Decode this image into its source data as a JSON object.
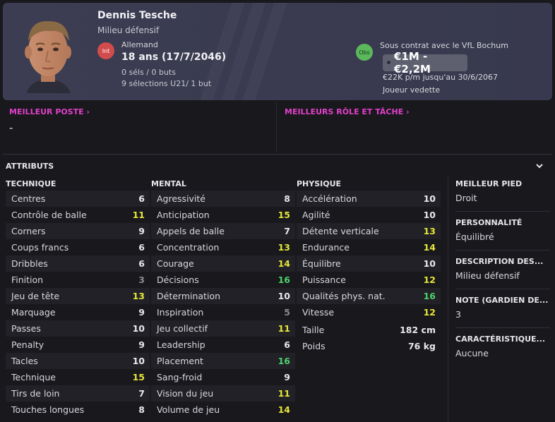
{
  "player": {
    "name": "Dennis Tesche",
    "position": "Milieu défensif",
    "int_badge": "Int",
    "nationality": "Allemand",
    "age": "18 ans (17/7/2046)",
    "caps": "0 séls / 0 buts",
    "u21": "9 sélections U21/ 1 but",
    "obs_badge": "Obs",
    "contract": "Sous contrat avec le VfL Bochum",
    "value": "€1M - €2,2M",
    "wage": "€22K p/m jusqu'au 30/6/2067",
    "status": "Joueur vedette"
  },
  "best": {
    "position_title": "MEILLEUR POSTE",
    "position_value": "-",
    "role_title": "MEILLEURS RÔLE ET TÂCHE"
  },
  "attributes": {
    "header": "ATTRIBUTS",
    "technique_title": "TECHNIQUE",
    "mental_title": "MENTAL",
    "physique_title": "PHYSIQUE",
    "technique": [
      {
        "label": "Centres",
        "value": "6"
      },
      {
        "label": "Contrôle de balle",
        "value": "11"
      },
      {
        "label": "Corners",
        "value": "9"
      },
      {
        "label": "Coups francs",
        "value": "6"
      },
      {
        "label": "Dribbles",
        "value": "6"
      },
      {
        "label": "Finition",
        "value": "3"
      },
      {
        "label": "Jeu de tête",
        "value": "13"
      },
      {
        "label": "Marquage",
        "value": "9"
      },
      {
        "label": "Passes",
        "value": "10"
      },
      {
        "label": "Penalty",
        "value": "9"
      },
      {
        "label": "Tacles",
        "value": "10"
      },
      {
        "label": "Technique",
        "value": "15"
      },
      {
        "label": "Tirs de loin",
        "value": "7"
      },
      {
        "label": "Touches longues",
        "value": "8"
      }
    ],
    "mental": [
      {
        "label": "Agressivité",
        "value": "8"
      },
      {
        "label": "Anticipation",
        "value": "15"
      },
      {
        "label": "Appels de balle",
        "value": "7"
      },
      {
        "label": "Concentration",
        "value": "13"
      },
      {
        "label": "Courage",
        "value": "14"
      },
      {
        "label": "Décisions",
        "value": "16"
      },
      {
        "label": "Détermination",
        "value": "10"
      },
      {
        "label": "Inspiration",
        "value": "5"
      },
      {
        "label": "Jeu collectif",
        "value": "11"
      },
      {
        "label": "Leadership",
        "value": "6"
      },
      {
        "label": "Placement",
        "value": "16"
      },
      {
        "label": "Sang-froid",
        "value": "9"
      },
      {
        "label": "Vision du jeu",
        "value": "11"
      },
      {
        "label": "Volume de jeu",
        "value": "14"
      }
    ],
    "physique": [
      {
        "label": "Accélération",
        "value": "10"
      },
      {
        "label": "Agilité",
        "value": "10"
      },
      {
        "label": "Détente verticale",
        "value": "13"
      },
      {
        "label": "Endurance",
        "value": "14"
      },
      {
        "label": "Équilibre",
        "value": "10"
      },
      {
        "label": "Puissance",
        "value": "12"
      },
      {
        "label": "Qualités phys. nat.",
        "value": "16"
      },
      {
        "label": "Vitesse",
        "value": "12"
      }
    ],
    "height_label": "Taille",
    "height_value": "182 cm",
    "weight_label": "Poids",
    "weight_value": "76 kg"
  },
  "side": {
    "foot_title": "MEILLEUR PIED",
    "foot_value": "Droit",
    "personality_title": "PERSONNALITÉ",
    "personality_value": "Équilibré",
    "description_title": "DESCRIPTION DES...",
    "description_value": "Milieu défensif",
    "gk_title": "NOTE (GARDIEN DE...",
    "gk_value": "3",
    "traits_title": "CARACTÉRISTIQUE...",
    "traits_value": "Aucune"
  },
  "colors": {
    "accent_pink": "#e040c8",
    "attr_yellow": "#e5e53a",
    "attr_green": "#4fd06a",
    "attr_grey": "#8a8a92"
  },
  "icons": {
    "collapse": "chevron-down-icon",
    "best_link": "chevron-right-icon"
  }
}
